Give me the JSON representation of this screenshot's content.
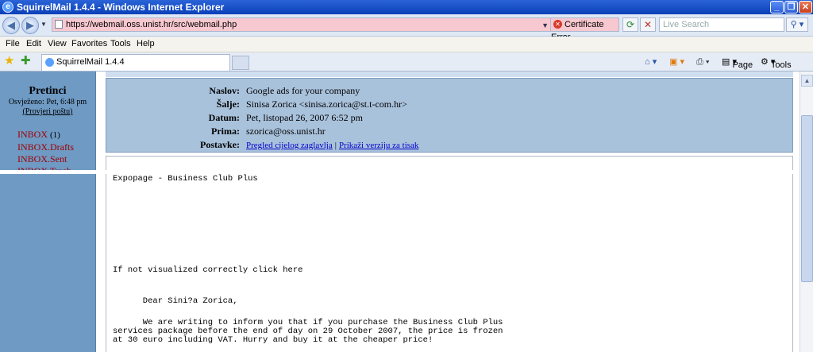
{
  "window": {
    "title": "SquirrelMail 1.4.4 - Windows Internet Explorer",
    "icon": "ie-icon"
  },
  "address_bar": {
    "url": "https://webmail.oss.unist.hr/src/webmail.php",
    "certificate_label": "Certificate Error",
    "search_placeholder": "Live Search"
  },
  "menu": {
    "items": [
      "File",
      "Edit",
      "View",
      "Favorites",
      "Tools",
      "Help"
    ]
  },
  "tabs": {
    "active_tab": "SquirrelMail 1.4.4",
    "page_label": "Page",
    "tools_label": "Tools"
  },
  "sidebar": {
    "title": "Pretinci",
    "updated": "Osvježeno: Pet, 6:48 pm",
    "check_mail": "(Provjeri poštu)",
    "folders": [
      {
        "name": "INBOX",
        "count": "(1)"
      },
      {
        "name": "INBOX.Drafts",
        "count": ""
      },
      {
        "name": "INBOX.Sent",
        "count": ""
      },
      {
        "name": "INBOX.Trash",
        "count": ""
      }
    ]
  },
  "message": {
    "labels": {
      "subject": "Naslov:",
      "from": "Šalje:",
      "date": "Datum:",
      "to": "Prima:",
      "options": "Postavke:"
    },
    "subject": "Google ads for your company",
    "from": "Sinisa Zorica <sinisa.zorica@st.t-com.hr>",
    "date": "Pet, listopad 26, 2007 6:52 pm",
    "to": "szorica@oss.unist.hr",
    "option_full_headers": "Pregled cijelog zaglavlja",
    "option_print": "Prikaži verziju za tisak",
    "body": {
      "line1": "Expopage - Business Club Plus",
      "line2": "If not visualized correctly click here",
      "line3": "      Dear Sini?a Zorica,",
      "line4": "      We are writing to inform you that if you purchase the Business Club Plus",
      "line5": "services package before the end of day on 29 October 2007, the price is frozen",
      "line6": "at 30 euro including VAT. Hurry and buy it at the cheaper price!"
    }
  },
  "colors": {
    "sidebar_bg": "#6e9ac4",
    "header_bg": "#a9c2dc",
    "folder_text": "#a00000",
    "link": "#0000cc",
    "address_error_bg": "#f8c8d0"
  }
}
